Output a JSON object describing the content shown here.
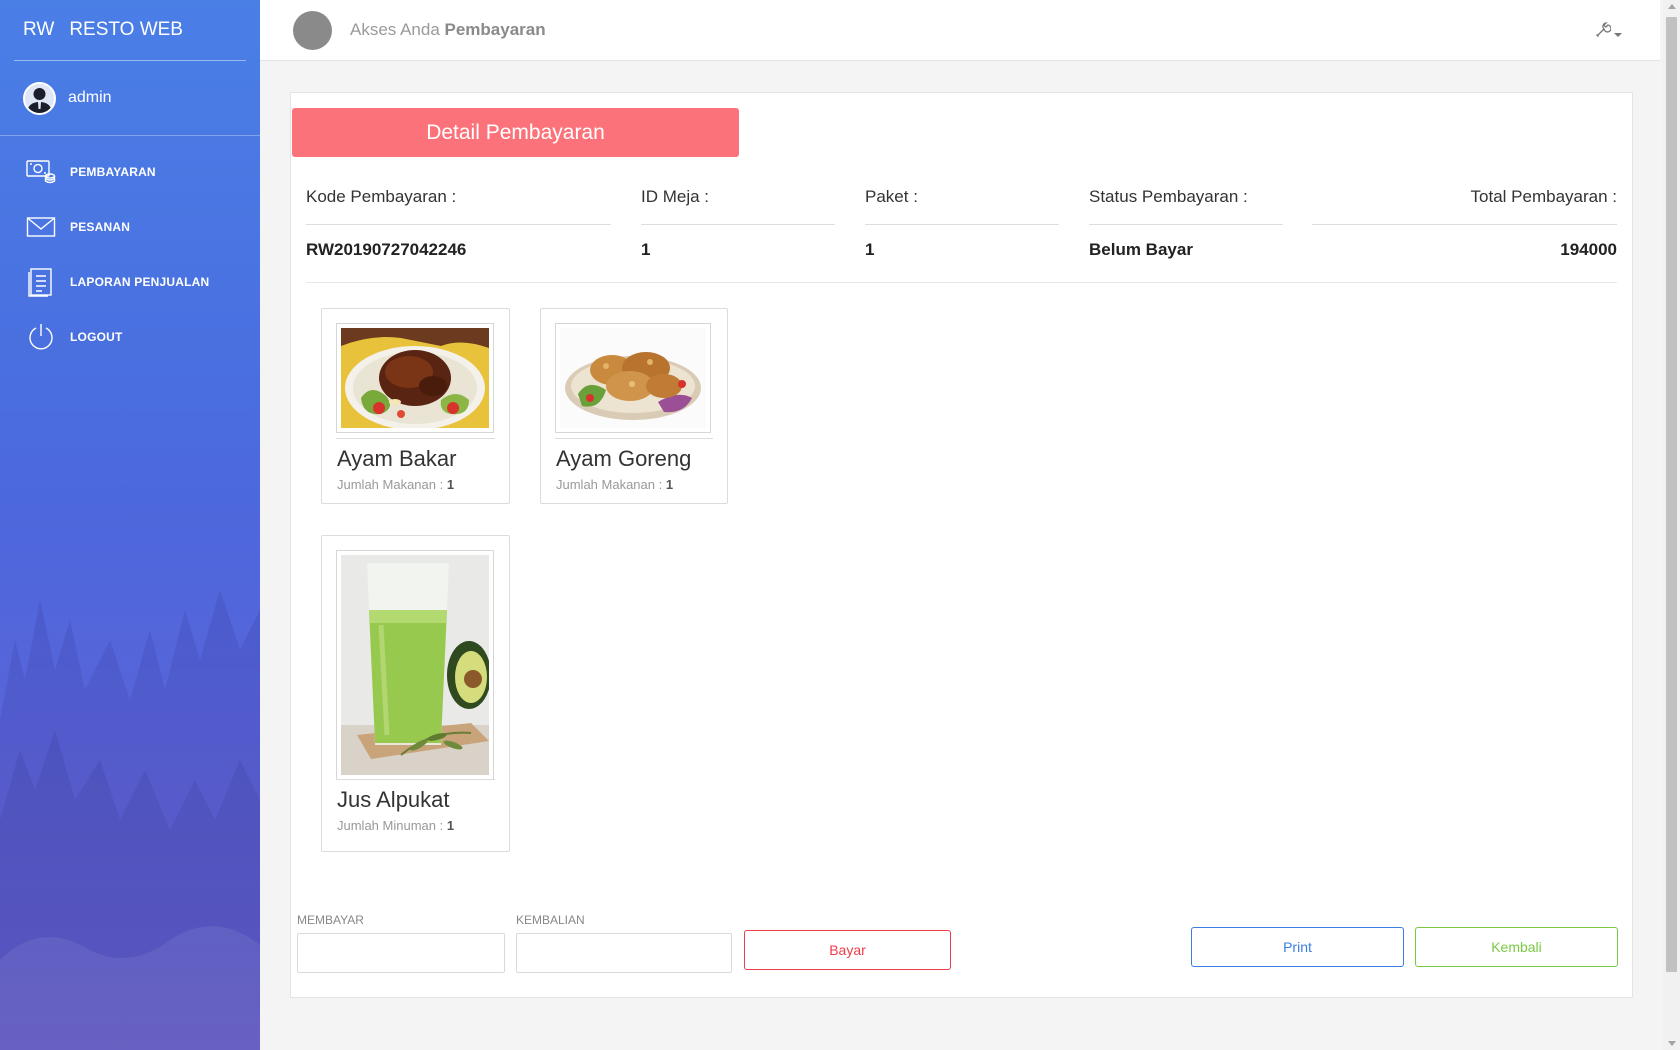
{
  "brand": {
    "short": "RW",
    "name": "RESTO WEB"
  },
  "user": {
    "name": "admin"
  },
  "nav": [
    {
      "label": "PEMBAYARAN",
      "icon": "payment-icon"
    },
    {
      "label": "PESANAN",
      "icon": "envelope-icon"
    },
    {
      "label": "LAPORAN PENJUALAN",
      "icon": "report-icon"
    },
    {
      "label": "LOGOUT",
      "icon": "power-icon"
    }
  ],
  "topbar": {
    "prefix": "Akses Anda",
    "section": "Pembayaran",
    "settings_icon": "wrench-icon"
  },
  "detail": {
    "title": "Detail Pembayaran",
    "kode_label": "Kode Pembayaran :",
    "kode_value": "RW20190727042246",
    "meja_label": "ID Meja :",
    "meja_value": "1",
    "paket_label": "Paket :",
    "paket_value": "1",
    "status_label": "Status Pembayaran :",
    "status_value": "Belum Bayar",
    "total_label": "Total Pembayaran :",
    "total_value": "194000"
  },
  "items": [
    {
      "name": "Ayam Bakar",
      "qty_label": "Jumlah Makanan :",
      "qty": "1"
    },
    {
      "name": "Ayam Goreng",
      "qty_label": "Jumlah Makanan :",
      "qty": "1"
    },
    {
      "name": "Jus Alpukat",
      "qty_label": "Jumlah Minuman :",
      "qty": "1"
    }
  ],
  "form": {
    "membayar_label": "MEMBAYAR",
    "membayar_value": "",
    "kembalian_label": "KEMBALIAN",
    "kembalian_value": "",
    "bayar_button": "Bayar",
    "print_button": "Print",
    "kembali_button": "Kembali"
  },
  "colors": {
    "sidebar_top": "#4a7fe6",
    "sidebar_bottom": "#5648cf",
    "header_button": "#fc727a",
    "bayar": "#ee3c4a",
    "print": "#3a7de2",
    "kembali": "#7ac943"
  }
}
